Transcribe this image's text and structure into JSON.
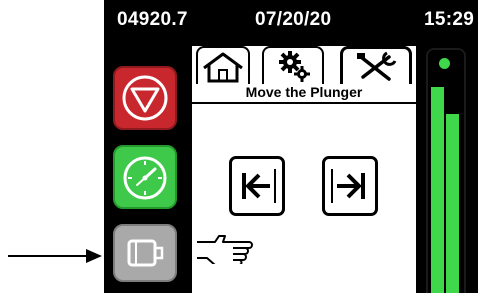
{
  "status_bar": {
    "counter": "04920.7",
    "date": "07/20/20",
    "time": "15:29"
  },
  "side_buttons": [
    {
      "name": "stop",
      "icon": "stop-triangle-icon",
      "color": "#c8282d"
    },
    {
      "name": "timer",
      "icon": "stopwatch-icon",
      "color": "#3ec94a"
    },
    {
      "name": "motor",
      "icon": "motor-icon",
      "color": "#a9a9a9"
    }
  ],
  "tabs": [
    {
      "name": "home",
      "icon": "home-icon"
    },
    {
      "name": "settings",
      "icon": "gears-icon"
    },
    {
      "name": "tools",
      "icon": "tools-icon",
      "active": true
    }
  ],
  "panel": {
    "title": "Move the Plunger",
    "buttons": [
      {
        "name": "move-left",
        "icon": "arrow-left-to-bar-icon"
      },
      {
        "name": "move-right",
        "icon": "arrow-right-to-bar-icon"
      }
    ]
  },
  "meter": {
    "indicator_color": "#3ed84a",
    "levels": [
      0.84,
      0.73
    ]
  },
  "annotation": {
    "arrow_icon": "arrow-right-icon",
    "hand_icon": "pointing-hand-icon"
  }
}
